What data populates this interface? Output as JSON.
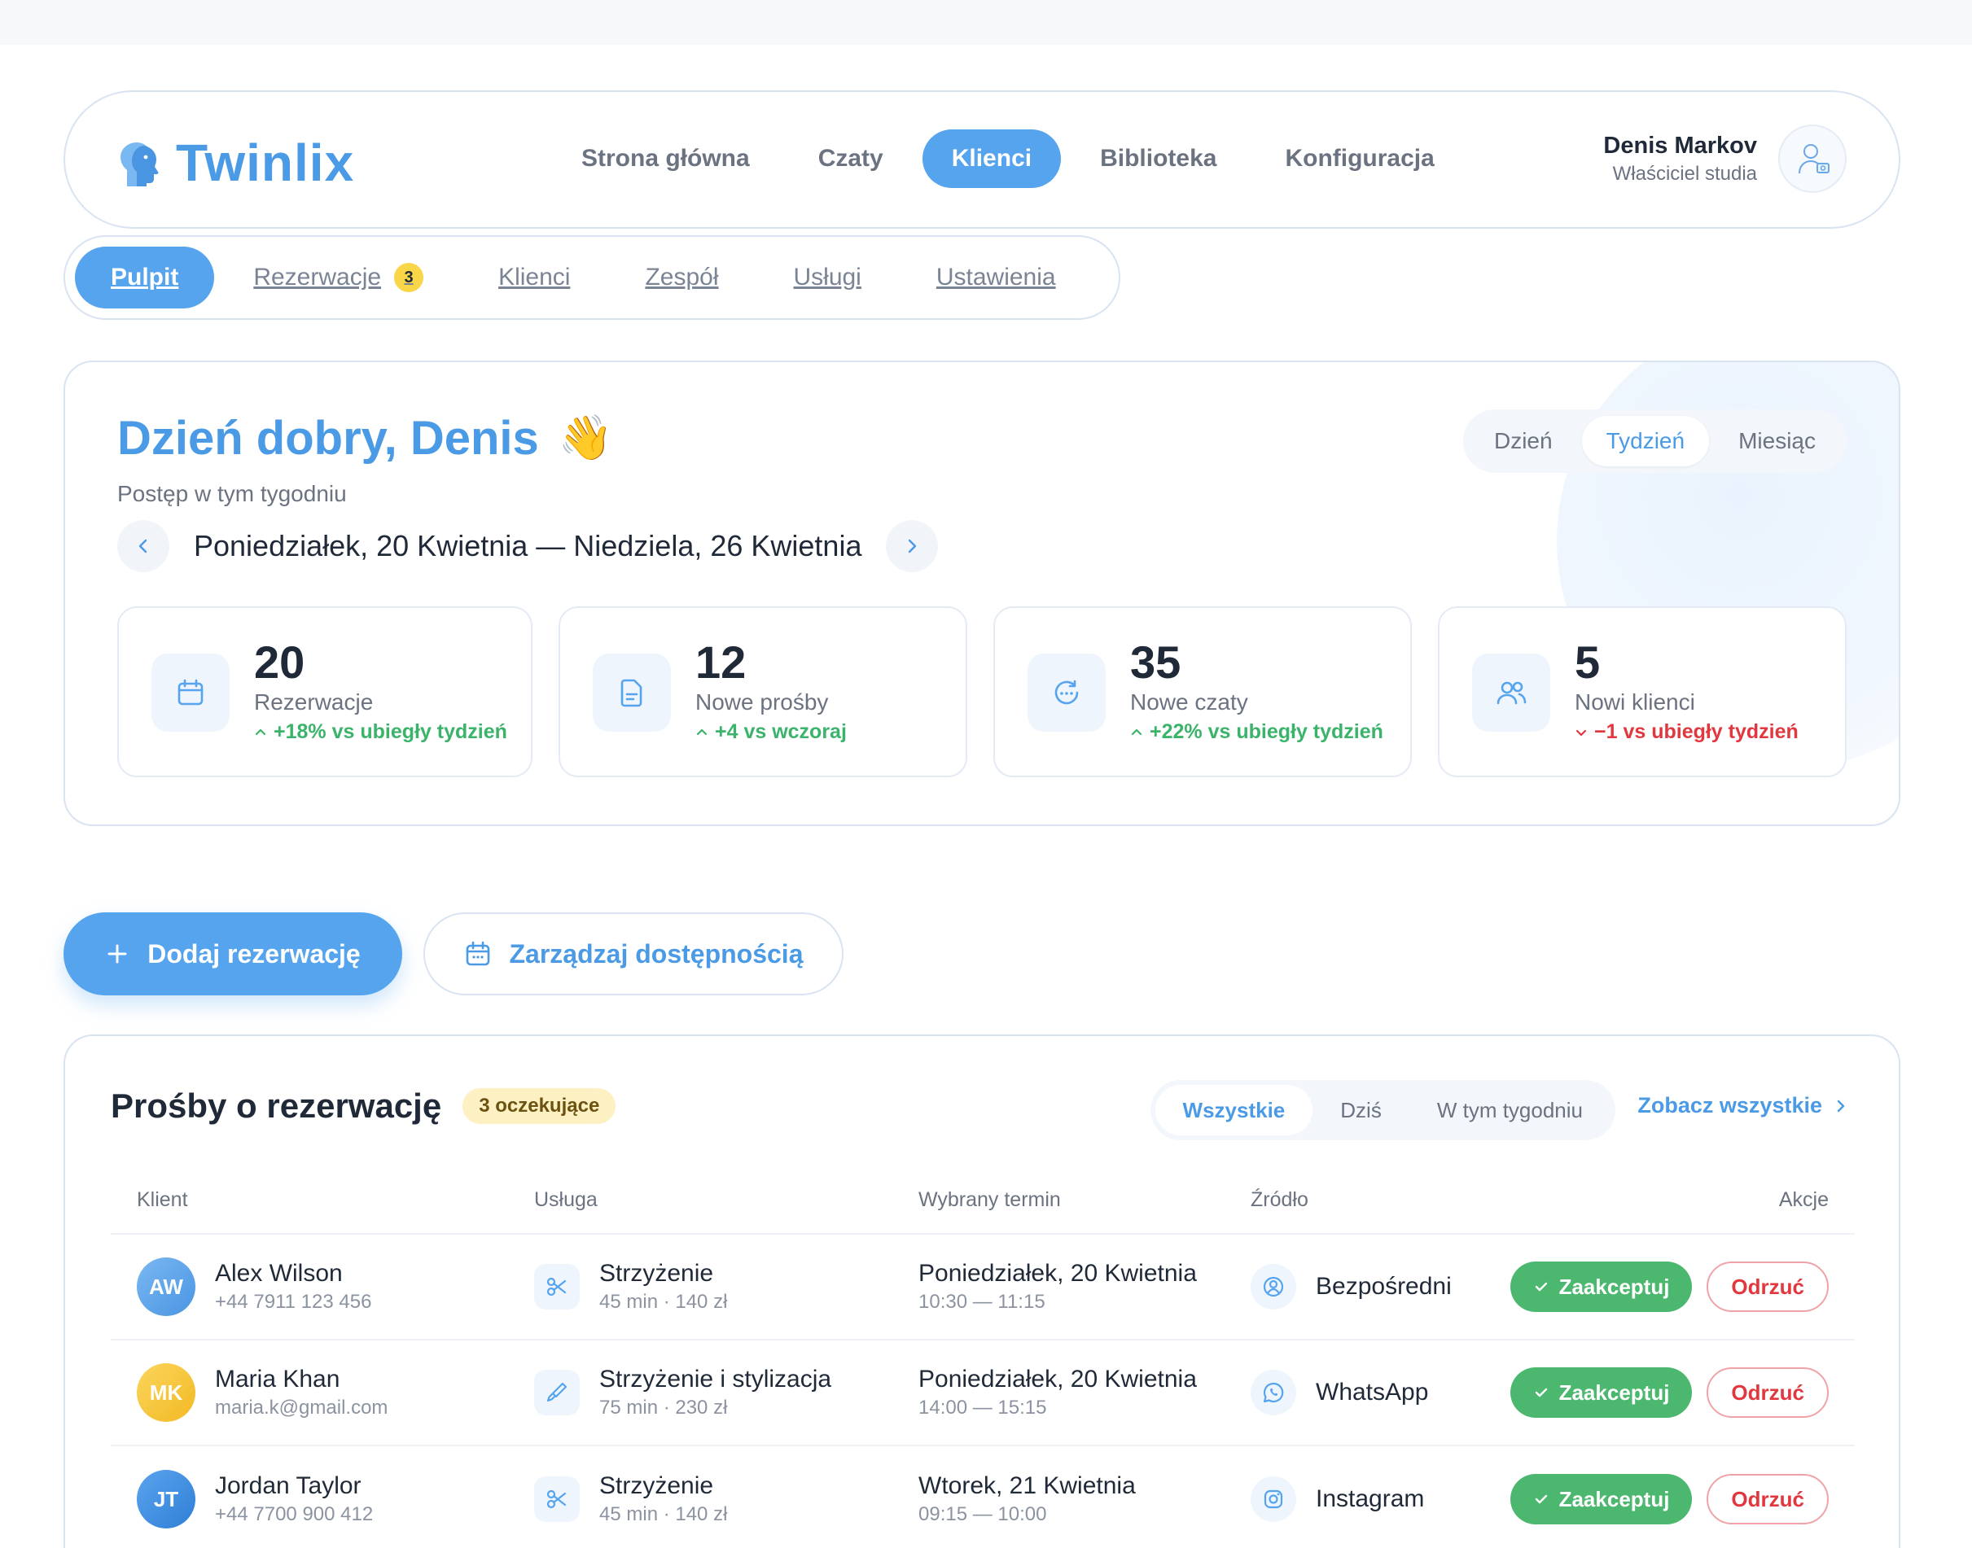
{
  "brand": {
    "name": "Twinlix"
  },
  "nav": {
    "items": [
      {
        "label": "Strona główna",
        "active": false
      },
      {
        "label": "Czaty",
        "active": false
      },
      {
        "label": "Klienci",
        "active": true
      },
      {
        "label": "Biblioteka",
        "active": false
      },
      {
        "label": "Konfiguracja",
        "active": false
      }
    ]
  },
  "user": {
    "name": "Denis Markov",
    "role": "Właściciel studia"
  },
  "subtabs": [
    {
      "label": "Pulpit",
      "active": true
    },
    {
      "label": "Rezerwacje",
      "badge": "3"
    },
    {
      "label": "Klienci"
    },
    {
      "label": "Zespół"
    },
    {
      "label": "Usługi"
    },
    {
      "label": "Ustawienia"
    }
  ],
  "welcome": {
    "greeting": "Dzień dobry, Denis",
    "emoji": "👋",
    "progress_label": "Postęp w tym tygodniu",
    "date_range": "Poniedziałek, 20 Kwietnia — Niedziela, 26 Kwietnia",
    "period_options": [
      "Dzień",
      "Tydzień",
      "Miesiąc"
    ],
    "period_selected": "Tydzień"
  },
  "stats": [
    {
      "icon": "calendar-icon",
      "value": "20",
      "label": "Rezerwacje",
      "trend": "+18% vs ubiegły tydzień",
      "direction": "up"
    },
    {
      "icon": "document-icon",
      "value": "12",
      "label": "Nowe prośby",
      "trend": "+4 vs wczoraj",
      "direction": "up"
    },
    {
      "icon": "chat-icon",
      "value": "35",
      "label": "Nowe czaty",
      "trend": "+22% vs ubiegły tydzień",
      "direction": "up"
    },
    {
      "icon": "users-icon",
      "value": "5",
      "label": "Nowi klienci",
      "trend": "−1 vs ubiegły tydzień",
      "direction": "down"
    }
  ],
  "actions": {
    "add_booking": "Dodaj rezerwację",
    "manage_availability": "Zarządzaj dostępnością"
  },
  "requests": {
    "title": "Prośby o rezerwację",
    "pending_badge": "3 oczekujące",
    "filters": [
      "Wszystkie",
      "Dziś",
      "W tym tygodniu"
    ],
    "filter_selected": "Wszystkie",
    "see_all": "Zobacz wszystkie",
    "columns": [
      "Klient",
      "Usługa",
      "Wybrany termin",
      "Źródło",
      "Akcje"
    ],
    "accept_label": "Zaakceptuj",
    "reject_label": "Odrzuć",
    "rows": [
      {
        "initials": "AW",
        "name": "Alex Wilson",
        "contact": "+44 7911 123 456",
        "service": "Strzyżenie",
        "service_meta": "45 min · 140 zł",
        "service_icon": "scissors-icon",
        "date": "Poniedziałek, 20 Kwietnia",
        "time": "10:30 — 11:15",
        "source": "Bezpośredni",
        "source_icon": "user-circle-icon"
      },
      {
        "initials": "MK",
        "name": "Maria Khan",
        "contact": "maria.k@gmail.com",
        "service": "Strzyżenie i stylizacja",
        "service_meta": "75 min · 230 zł",
        "service_icon": "brush-icon",
        "date": "Poniedziałek, 20 Kwietnia",
        "time": "14:00 — 15:15",
        "source": "WhatsApp",
        "source_icon": "whatsapp-icon"
      },
      {
        "initials": "JT",
        "name": "Jordan Taylor",
        "contact": "+44 7700 900 412",
        "service": "Strzyżenie",
        "service_meta": "45 min · 140 zł",
        "service_icon": "scissors-icon",
        "date": "Wtorek, 21 Kwietnia",
        "time": "09:15 — 10:00",
        "source": "Instagram",
        "source_icon": "instagram-icon"
      }
    ]
  },
  "colors": {
    "accent": "#56a4ee",
    "success": "#4cb86f",
    "danger": "#e0383e",
    "badge": "#f9d648"
  }
}
